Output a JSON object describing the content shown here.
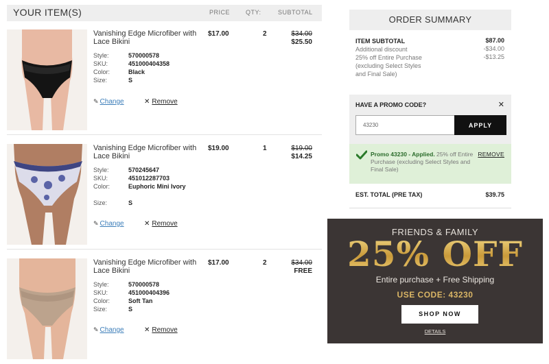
{
  "cart": {
    "title": "YOUR ITEM(S)",
    "columns": {
      "price": "PRICE",
      "qty": "QTY:",
      "subtotal": "SUBTOTAL"
    },
    "labels": {
      "style": "Style:",
      "sku": "SKU:",
      "color": "Color:",
      "size": "Size:",
      "change": "Change",
      "remove": "Remove"
    },
    "items": [
      {
        "name": "Vanishing Edge Microfiber with Lace Bikini",
        "style": "570000578",
        "sku": "451000404358",
        "color": "Black",
        "size": "S",
        "price": "$17.00",
        "qty": "2",
        "subtotal_old": "$34.00",
        "subtotal_new": "$25.50",
        "swatch": "#1a1a1a"
      },
      {
        "name": "Vanishing Edge Microfiber with Lace Bikini",
        "style": "570245647",
        "sku": "451012287703",
        "color": "Euphoric Mini Ivory",
        "size": "S",
        "price": "$19.00",
        "qty": "1",
        "subtotal_old": "$19.00",
        "subtotal_new": "$14.25",
        "swatch": "#8a8fb8"
      },
      {
        "name": "Vanishing Edge Microfiber with Lace Bikini",
        "style": "570000578",
        "sku": "451000404396",
        "color": "Soft Tan",
        "size": "S",
        "price": "$17.00",
        "qty": "2",
        "subtotal_old": "$34.00",
        "subtotal_new": "FREE",
        "swatch": "#b89c84"
      }
    ]
  },
  "summary": {
    "title": "ORDER SUMMARY",
    "item_subtotal_label": "ITEM SUBTOTAL",
    "item_subtotal_value": "$87.00",
    "additional_discount_label": "Additional discount",
    "additional_discount_value": "-$34.00",
    "promo_discount_label": "25% off Entire Purchase (excluding Select Styles and Final Sale)",
    "promo_discount_value": "-$13.25",
    "promo_question": "HAVE A PROMO CODE?",
    "promo_input_value": "43230",
    "apply_label": "APPLY",
    "applied_strong": "Promo 43230 - Applied.",
    "applied_detail": " 25% off Entire Purchase (excluding Select Styles and Final Sale)",
    "applied_remove": "REMOVE",
    "est_total_label": "EST. TOTAL (PRE TAX)",
    "est_total_value": "$39.75"
  },
  "banner": {
    "heading": "FRIENDS & FAMILY",
    "big": "25% OFF",
    "sub": "Entire purchase + Free Shipping",
    "code": "USE CODE: 43230",
    "shop_label": "SHOP NOW",
    "details_label": "DETAILS"
  },
  "colors": {
    "accent_green": "#2a6b2a",
    "link_blue": "#3a7cb8",
    "banner_bg": "#3b3534",
    "gold": "#d6b25a"
  }
}
